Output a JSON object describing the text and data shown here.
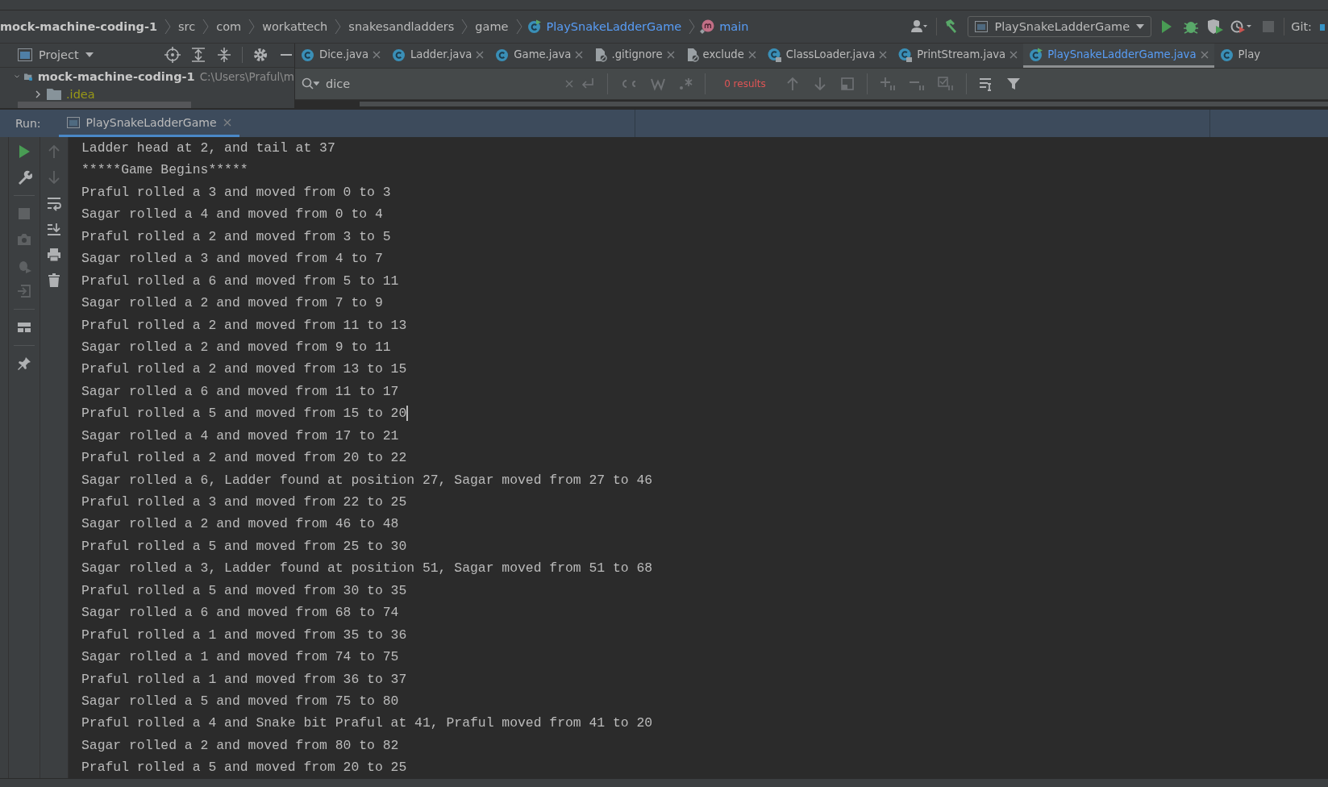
{
  "breadcrumbs": [
    {
      "label": "mock-machine-coding-1",
      "kind": "project"
    },
    {
      "label": "src",
      "kind": "folder"
    },
    {
      "label": "com",
      "kind": "folder"
    },
    {
      "label": "workattech",
      "kind": "folder"
    },
    {
      "label": "snakesandladders",
      "kind": "folder"
    },
    {
      "label": "game",
      "kind": "folder"
    },
    {
      "label": "PlaySnakeLadderGame",
      "kind": "class"
    },
    {
      "label": "main",
      "kind": "method"
    }
  ],
  "run_config": {
    "label": "PlaySnakeLadderGame"
  },
  "git_label": "Git:",
  "project_panel": {
    "title": "Project",
    "root": {
      "label": "mock-machine-coding-1",
      "path": "C:\\Users\\Praful\\m",
      "expanded": true,
      "children": [
        {
          "label": ".idea",
          "expanded": false
        }
      ]
    }
  },
  "editor_tabs": [
    {
      "label": "Dice.java",
      "kind": "class",
      "selected": false
    },
    {
      "label": "Ladder.java",
      "kind": "class",
      "selected": false
    },
    {
      "label": "Game.java",
      "kind": "class",
      "selected": false
    },
    {
      "label": ".gitignore",
      "kind": "file",
      "selected": false
    },
    {
      "label": "exclude",
      "kind": "file",
      "selected": false
    },
    {
      "label": "ClassLoader.java",
      "kind": "locked-class",
      "selected": false
    },
    {
      "label": "PrintStream.java",
      "kind": "locked-class",
      "selected": false
    },
    {
      "label": "PlaySnakeLadderGame.java",
      "kind": "runnable-class",
      "selected": true
    },
    {
      "label": "Play",
      "kind": "class",
      "selected": false
    }
  ],
  "search": {
    "value": "dice",
    "results": "0 results"
  },
  "run_panel": {
    "label": "Run:",
    "tabs": [
      {
        "label": "PlaySnakeLadderGame",
        "selected": true
      }
    ]
  },
  "console": {
    "lines": [
      {
        "text": "Ladder head at 2, and tail at 37",
        "cursor": false
      },
      {
        "text": "*****Game Begins*****",
        "cursor": false
      },
      {
        "text": "Praful rolled a 3 and moved from 0 to 3",
        "cursor": false
      },
      {
        "text": "Sagar rolled a 4 and moved from 0 to 4",
        "cursor": false
      },
      {
        "text": "Praful rolled a 2 and moved from 3 to 5",
        "cursor": false
      },
      {
        "text": "Sagar rolled a 3 and moved from 4 to 7",
        "cursor": false
      },
      {
        "text": "Praful rolled a 6 and moved from 5 to 11",
        "cursor": false
      },
      {
        "text": "Sagar rolled a 2 and moved from 7 to 9",
        "cursor": false
      },
      {
        "text": "Praful rolled a 2 and moved from 11 to 13",
        "cursor": false
      },
      {
        "text": "Sagar rolled a 2 and moved from 9 to 11",
        "cursor": false
      },
      {
        "text": "Praful rolled a 2 and moved from 13 to 15",
        "cursor": false
      },
      {
        "text": "Sagar rolled a 6 and moved from 11 to 17",
        "cursor": false
      },
      {
        "text": "Praful rolled a 5 and moved from 15 to 20",
        "cursor": true
      },
      {
        "text": "Sagar rolled a 4 and moved from 17 to 21",
        "cursor": false
      },
      {
        "text": "Praful rolled a 2 and moved from 20 to 22",
        "cursor": false
      },
      {
        "text": "Sagar rolled a 6, Ladder found at position 27, Sagar moved from 27 to 46",
        "cursor": false
      },
      {
        "text": "Praful rolled a 3 and moved from 22 to 25",
        "cursor": false
      },
      {
        "text": "Sagar rolled a 2 and moved from 46 to 48",
        "cursor": false
      },
      {
        "text": "Praful rolled a 5 and moved from 25 to 30",
        "cursor": false
      },
      {
        "text": "Sagar rolled a 3, Ladder found at position 51, Sagar moved from 51 to 68",
        "cursor": false
      },
      {
        "text": "Praful rolled a 5 and moved from 30 to 35",
        "cursor": false
      },
      {
        "text": "Sagar rolled a 6 and moved from 68 to 74",
        "cursor": false
      },
      {
        "text": "Praful rolled a 1 and moved from 35 to 36",
        "cursor": false
      },
      {
        "text": "Sagar rolled a 1 and moved from 74 to 75",
        "cursor": false
      },
      {
        "text": "Praful rolled a 1 and moved from 36 to 37",
        "cursor": false
      },
      {
        "text": "Sagar rolled a 5 and moved from 75 to 80",
        "cursor": false
      },
      {
        "text": "Praful rolled a 4 and Snake bit Praful at 41, Praful moved from 41 to 20",
        "cursor": false
      },
      {
        "text": "Sagar rolled a 2 and moved from 80 to 82",
        "cursor": false
      },
      {
        "text": "Praful rolled a 5 and moved from 20 to 25",
        "cursor": false
      }
    ]
  }
}
